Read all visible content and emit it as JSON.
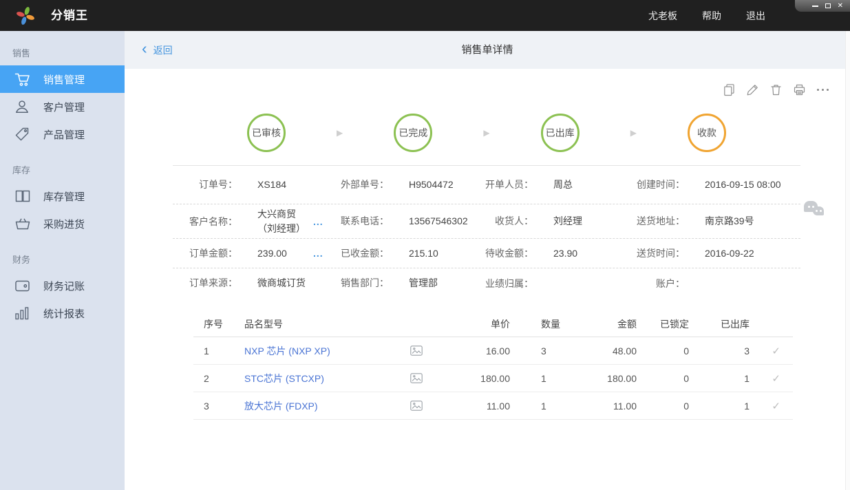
{
  "topbar": {
    "app_name": "分销王",
    "menu": [
      {
        "label": "尤老板"
      },
      {
        "label": "帮助"
      },
      {
        "label": "退出"
      }
    ],
    "window_controls": {
      "close_glyph": "✕"
    }
  },
  "sidebar": {
    "sections": [
      {
        "label": "销售",
        "items": [
          {
            "label": "销售管理",
            "icon": "cart-icon",
            "active": true
          },
          {
            "label": "客户管理",
            "icon": "user-icon",
            "active": false
          },
          {
            "label": "产品管理",
            "icon": "tag-icon",
            "active": false
          }
        ]
      },
      {
        "label": "库存",
        "items": [
          {
            "label": "库存管理",
            "icon": "book-icon",
            "active": false
          },
          {
            "label": "采购进货",
            "icon": "basket-icon",
            "active": false
          }
        ]
      },
      {
        "label": "财务",
        "items": [
          {
            "label": "财务记账",
            "icon": "wallet-icon",
            "active": false
          },
          {
            "label": "统计报表",
            "icon": "bar-chart-icon",
            "active": false
          }
        ]
      }
    ]
  },
  "header": {
    "back_chevron": "‹",
    "back_label": "返回",
    "title": "销售单详情"
  },
  "toolbar": {
    "icons": [
      "copy-icon",
      "edit-icon",
      "delete-icon",
      "print-icon",
      "more-icon"
    ]
  },
  "status_flow": {
    "arrow_glyph": "▶",
    "steps": [
      {
        "label": "已审核",
        "color": "#8cc152"
      },
      {
        "label": "已完成",
        "color": "#8cc152"
      },
      {
        "label": "已出库",
        "color": "#8cc152"
      },
      {
        "label": "收款",
        "color": "#f0a431"
      }
    ]
  },
  "order_info": {
    "rows": [
      {
        "cells": [
          {
            "label": "订单号：",
            "value": "XS184"
          },
          {
            "label": "外部单号：",
            "value": "H9504472"
          },
          {
            "label": "开单人员：",
            "value": "周总"
          },
          {
            "label": "创建时间：",
            "value": "2016-09-15 08:00"
          }
        ]
      },
      {
        "cells": [
          {
            "label": "客户名称：",
            "value": "大兴商贸\n（刘经理）",
            "more": "..."
          },
          {
            "label": "联系电话：",
            "value": "13567546302"
          },
          {
            "label": "收货人：",
            "value": "刘经理"
          },
          {
            "label": "送货地址：",
            "value": "南京路39号"
          }
        ]
      },
      {
        "cells": [
          {
            "label": "订单金额：",
            "value": "239.00",
            "more": "..."
          },
          {
            "label": "已收金额：",
            "value": "215.10"
          },
          {
            "label": "待收金额：",
            "value": "23.90"
          },
          {
            "label": "送货时间：",
            "value": "2016-09-22"
          }
        ]
      },
      {
        "cells": [
          {
            "label": "订单来源：",
            "value": "微商城订货"
          },
          {
            "label": "销售部门：",
            "value": "管理部"
          },
          {
            "label": "业绩归属：",
            "value": ""
          },
          {
            "label": "账户：",
            "value": ""
          }
        ]
      }
    ]
  },
  "product_table": {
    "columns": [
      "序号",
      "品名型号",
      "单价",
      "数量",
      "金额",
      "已锁定",
      "已出库"
    ],
    "check_glyph": "✓",
    "rows": [
      {
        "seq": "1",
        "name": "NXP 芯片 (NXP XP)",
        "price": "16.00",
        "qty": "3",
        "amount": "48.00",
        "locked": "0",
        "shipped": "3"
      },
      {
        "seq": "2",
        "name": "STC芯片 (STCXP)",
        "price": "180.00",
        "qty": "1",
        "amount": "180.00",
        "locked": "0",
        "shipped": "1"
      },
      {
        "seq": "3",
        "name": "放大芯片 (FDXP)",
        "price": "11.00",
        "qty": "1",
        "amount": "11.00",
        "locked": "0",
        "shipped": "1"
      }
    ]
  },
  "colors": {
    "topbar_bg": "#202020",
    "sidebar_bg": "#dbe2ee",
    "active_item_bg": "#47a4f4",
    "header_bg": "#eff2f6",
    "link_blue": "#4193de",
    "product_link_blue": "#4a74d4",
    "status_green": "#8cc152",
    "status_orange": "#f0a431"
  }
}
